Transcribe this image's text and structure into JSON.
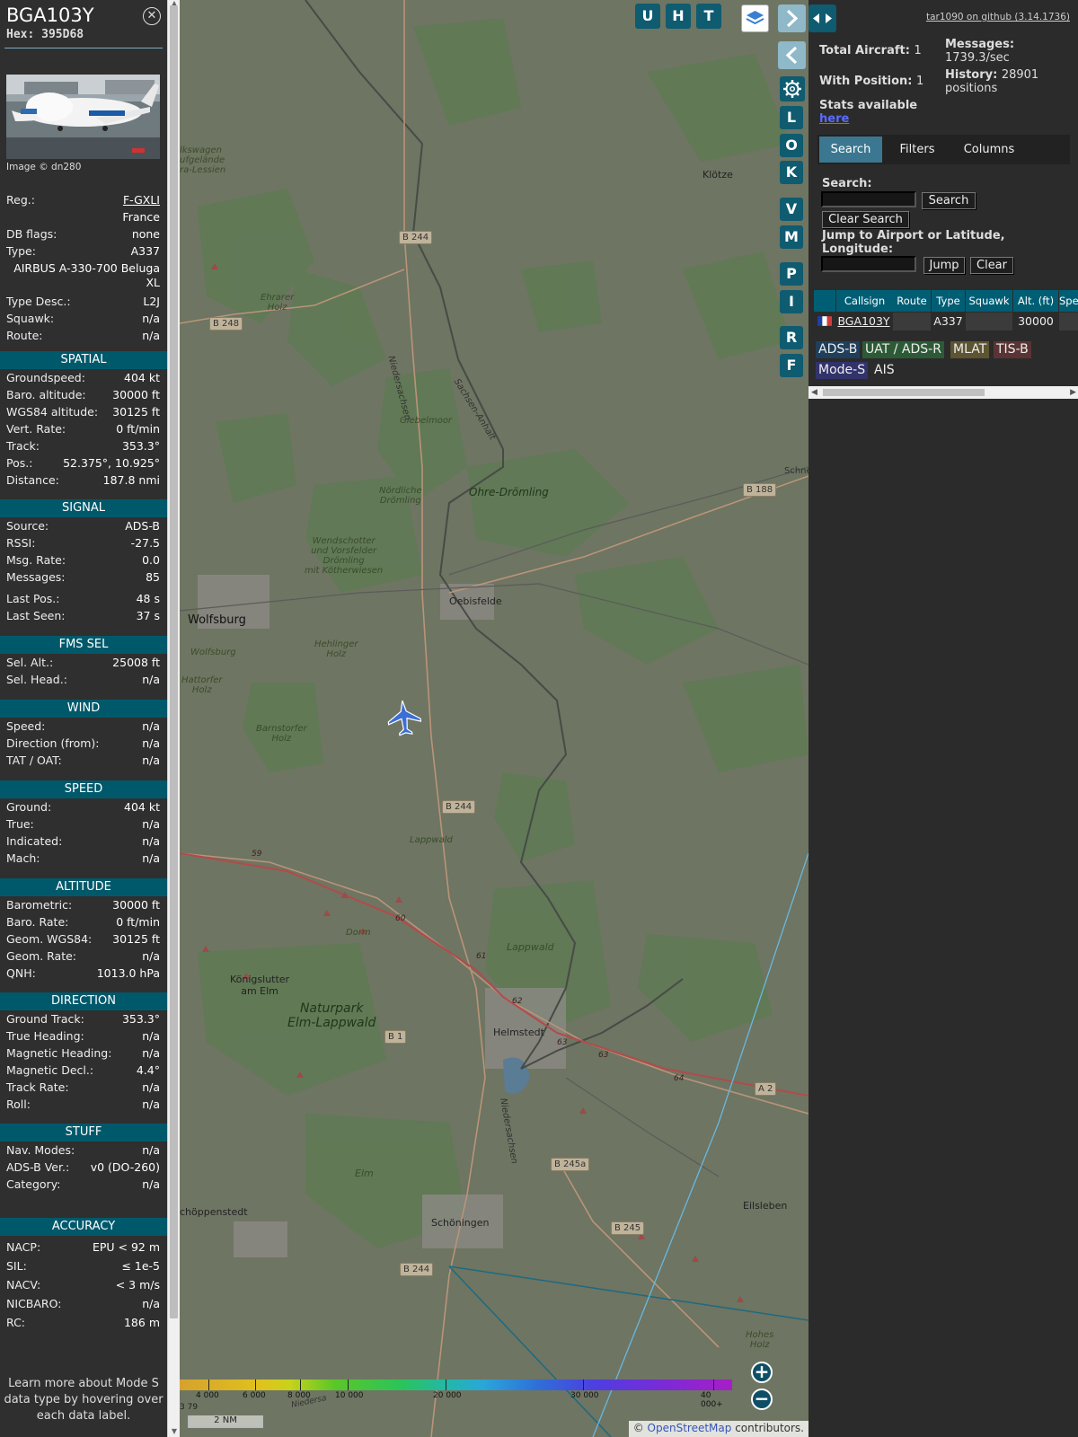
{
  "aircraft": {
    "callsign": "BGA103Y",
    "hex": "Hex: 395D68",
    "close_icon": "close-icon",
    "photo_credit": "Image © dn280"
  },
  "details": [
    {
      "k": "Reg.:",
      "v": "F-GXLI"
    },
    {
      "k": "",
      "v": "France"
    },
    {
      "k": "DB flags:",
      "v": "none"
    },
    {
      "k": "Type:",
      "v": "A337"
    },
    {
      "k": "",
      "v": "AIRBUS A-330-700 Beluga"
    },
    {
      "k": "",
      "v": "XL"
    },
    {
      "k": "Type Desc.:",
      "v": "L2J"
    },
    {
      "k": "Squawk:",
      "v": "n/a"
    },
    {
      "k": "Route:",
      "v": "n/a"
    }
  ],
  "sections": [
    {
      "title": "SPATIAL",
      "rows": [
        {
          "k": "Groundspeed:",
          "v": "404 kt"
        },
        {
          "k": "Baro. altitude:",
          "v": "30000 ft"
        },
        {
          "k": "WGS84 altitude:",
          "v": "30125 ft"
        },
        {
          "k": "Vert. Rate:",
          "v": "0 ft/min"
        },
        {
          "k": "Track:",
          "v": "353.3°"
        },
        {
          "k": "Pos.:",
          "v": "52.375°, 10.925°"
        },
        {
          "k": "Distance:",
          "v": "187.8 nmi"
        }
      ]
    },
    {
      "title": "SIGNAL",
      "rows": [
        {
          "k": "Source:",
          "v": "ADS-B"
        },
        {
          "k": "RSSI:",
          "v": "-27.5"
        },
        {
          "k": "Msg. Rate:",
          "v": "0.0"
        },
        {
          "k": "Messages:",
          "v": "85"
        },
        {
          "k": "Last Pos.:",
          "v": "48 s"
        },
        {
          "k": "Last Seen:",
          "v": "37 s"
        }
      ]
    },
    {
      "title": "FMS SEL",
      "rows": [
        {
          "k": "Sel. Alt.:",
          "v": "25008 ft"
        },
        {
          "k": "Sel. Head.:",
          "v": "n/a"
        }
      ]
    },
    {
      "title": "WIND",
      "rows": [
        {
          "k": "Speed:",
          "v": "n/a"
        },
        {
          "k": "Direction (from):",
          "v": "n/a"
        },
        {
          "k": "TAT / OAT:",
          "v": "n/a"
        }
      ]
    },
    {
      "title": "SPEED",
      "rows": [
        {
          "k": "Ground:",
          "v": "404 kt"
        },
        {
          "k": "True:",
          "v": "n/a"
        },
        {
          "k": "Indicated:",
          "v": "n/a"
        },
        {
          "k": "Mach:",
          "v": "n/a"
        }
      ]
    },
    {
      "title": "ALTITUDE",
      "rows": [
        {
          "k": "Barometric:",
          "v": "30000 ft"
        },
        {
          "k": "Baro. Rate:",
          "v": "0 ft/min"
        },
        {
          "k": "Geom. WGS84:",
          "v": "30125 ft"
        },
        {
          "k": "Geom. Rate:",
          "v": "n/a"
        },
        {
          "k": "QNH:",
          "v": "1013.0 hPa"
        }
      ]
    },
    {
      "title": "DIRECTION",
      "rows": [
        {
          "k": "Ground Track:",
          "v": "353.3°"
        },
        {
          "k": "True Heading:",
          "v": "n/a"
        },
        {
          "k": "Magnetic Heading:",
          "v": "n/a"
        },
        {
          "k": "Magnetic Decl.:",
          "v": "4.4°"
        },
        {
          "k": "Track Rate:",
          "v": "n/a"
        },
        {
          "k": "Roll:",
          "v": "n/a"
        }
      ]
    },
    {
      "title": "STUFF",
      "rows": [
        {
          "k": "Nav. Modes:",
          "v": "n/a"
        },
        {
          "k": "ADS-B Ver.:",
          "v": "v0 (DO-260)"
        },
        {
          "k": "Category:",
          "v": "n/a"
        }
      ]
    },
    {
      "title": "ACCURACY",
      "rows": [
        {
          "k": "NACP:",
          "v": "EPU < 92 m"
        },
        {
          "k": "SIL:",
          "v": "≤ 1e-5"
        },
        {
          "k": "NACV:",
          "v": "< 3 m/s"
        },
        {
          "k": "NICBARO:",
          "v": "n/a"
        },
        {
          "k": "RC:",
          "v": "186 m"
        }
      ]
    }
  ],
  "footer_note": "Learn more about Mode S data type by hovering over each data label.",
  "map": {
    "top_buttons": [
      "U",
      "H",
      "T"
    ],
    "side_buttons": [
      "L",
      "O",
      "K",
      "V",
      "M",
      "P",
      "I",
      "R",
      "F"
    ],
    "layers_icon": "layers-icon",
    "settings_icon": "gear-icon",
    "labels": {
      "wolfsburg": "Wolfsburg",
      "wolfsburg_small": "Wolfsburg",
      "oebisfelde": "Oebisfelde",
      "klotze": "Klötze",
      "helmstedt": "Helmstedt",
      "schoningen": "Schöningen",
      "eilsleben": "Eilsleben",
      "konigslutter": "Königslutter\nam Elm",
      "schoppenstedt": "chöppenstedt",
      "naturpark": "Naturpark\nElm-Lappwald",
      "ohre": "Ohre-Drömling",
      "lappwald": "Lappwald",
      "lappwald2": "Lappwald",
      "elm": "Elm",
      "dorm": "Dorm",
      "ehrarer": "Ehrarer\nHolz",
      "giebelmoor": "Giebelmoor",
      "nordliche": "Nördliche\nDrömling",
      "wendschotter": "Wendschotter\nund Vorsfelder\nDrömling\nmit Kötherwiesen",
      "hehlinger": "Hehlinger\nHolz",
      "hattorfer": "Hattorfer\nHolz",
      "barnstorfer": "Barnstorfer\nHolz",
      "hohes": "Hohes\nHolz",
      "vw": "lkswagen\nufgelände\nra-Lessien",
      "niedersachsen": "Niedersachsen",
      "sachsen": "Sachsen-Anhalt",
      "niedersachsen2": "Niedersachsen",
      "schne": "Schne"
    },
    "roads": {
      "b244a": "B 244",
      "b248": "B 248",
      "b188": "B 188",
      "b244b": "B 244",
      "b1": "B 1",
      "a2": "A 2",
      "b245a": "B 245a",
      "b245": "B 245",
      "b244c": "B 244"
    },
    "exits": [
      "59",
      "60",
      "61",
      "62",
      "63",
      "63",
      "64"
    ],
    "altitude_ticks": [
      "4 000",
      "6 000",
      "8 000",
      "10 000",
      "20 000",
      "30 000",
      "40 000+"
    ],
    "scale": "2 NM",
    "attribution_prefix": "© ",
    "attribution_link": "OpenStreetMap",
    "attribution_suffix": " contributors.",
    "edge_label_379": "3 79",
    "edge_label_nied": "Niedersa"
  },
  "right": {
    "github": "tar1090 on github (3.14.1736)",
    "total_label": "Total Aircraft:",
    "total_value": "1",
    "withpos_label": "With Position:",
    "withpos_value": "1",
    "messages_label": "Messages:",
    "messages_value": "1739.3/sec",
    "history_label": "History:",
    "history_value": "28901",
    "history_unit": "positions",
    "stats_label": "Stats available",
    "stats_link": "here",
    "tabs": [
      "Search",
      "Filters",
      "Columns"
    ],
    "search_label": "Search:",
    "search_button": "Search",
    "clear_search_button": "Clear Search",
    "jump_label": "Jump to Airport or Latitude, Longitude:",
    "jump_button": "Jump",
    "clear_button": "Clear",
    "table_headers": [
      "Callsign",
      "Route",
      "Type",
      "Squawk",
      "Alt. (ft)",
      "Spe"
    ],
    "table_row": {
      "callsign": "BGA103Y",
      "route": "",
      "type": "A337",
      "squawk": "",
      "alt": "30000",
      "speed": ""
    },
    "legend": [
      {
        "label": "ADS-B",
        "color": "#1f3f5b"
      },
      {
        "label": "UAT / ADS-R",
        "color": "#2d5a36"
      },
      {
        "label": "MLAT",
        "color": "#5d5431"
      },
      {
        "label": "TIS-B",
        "color": "#5a3434"
      },
      {
        "label": "Mode-S",
        "color": "#32336b"
      },
      {
        "label": "AIS",
        "color": "#2b2b2b"
      }
    ]
  }
}
